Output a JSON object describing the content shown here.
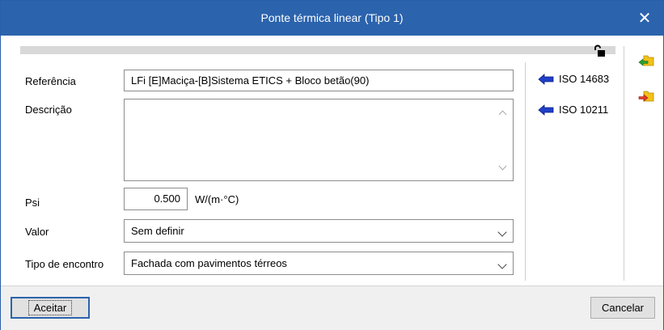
{
  "window": {
    "title": "Ponte térmica linear (Tipo 1)"
  },
  "form": {
    "referencia": {
      "label": "Referência",
      "value": "LFi [E]Maciça-[B]Sistema ETICS + Bloco betão(90)"
    },
    "descricao": {
      "label": "Descrição",
      "value": ""
    },
    "psi": {
      "label": "Psi",
      "value": "0.500",
      "unit": "W/(m·°C)"
    },
    "valor": {
      "label": "Valor",
      "selected": "Sem definir"
    },
    "tipo_encontro": {
      "label": "Tipo de encontro",
      "selected": "Fachada com pavimentos térreos"
    }
  },
  "links": [
    {
      "label": "ISO 14683",
      "icon": "blue-left-arrow-icon"
    },
    {
      "label": "ISO 10211",
      "icon": "blue-left-arrow-icon"
    }
  ],
  "side_icons": [
    "import-icon",
    "export-icon"
  ],
  "buttons": {
    "accept": "Aceitar",
    "cancel": "Cancelar"
  },
  "colors": {
    "titlebar": "#2b63ad",
    "arrow_blue": "#1f3fc8",
    "folder_yellow": "#f2c218"
  }
}
